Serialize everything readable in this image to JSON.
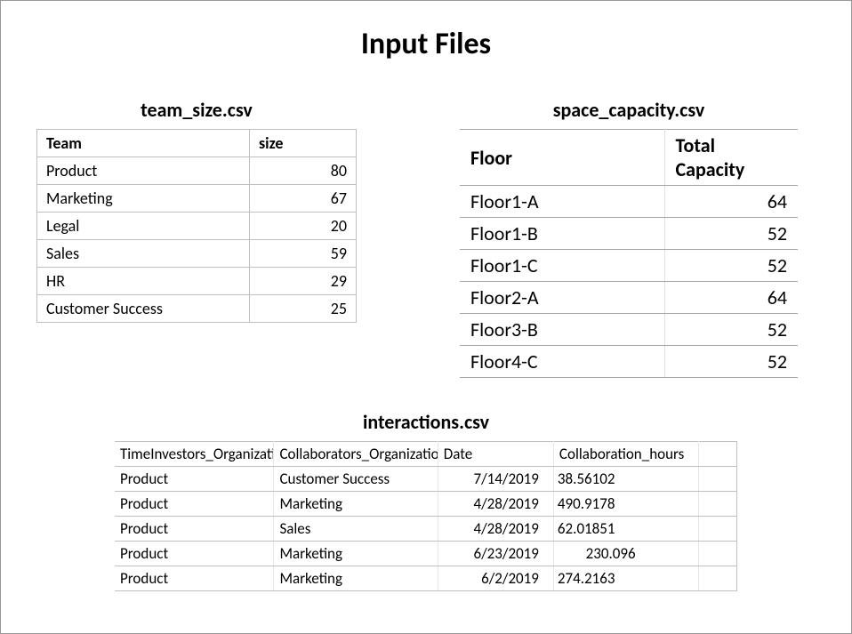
{
  "title": "Input Files",
  "team_size": {
    "filename": "team_size.csv",
    "headers": [
      "Team",
      "size"
    ],
    "rows": [
      {
        "team": "Product",
        "size": "80"
      },
      {
        "team": "Marketing",
        "size": "67"
      },
      {
        "team": "Legal",
        "size": "20"
      },
      {
        "team": "Sales",
        "size": "59"
      },
      {
        "team": "HR",
        "size": "29"
      },
      {
        "team": "Customer Success",
        "size": "25"
      }
    ]
  },
  "space_capacity": {
    "filename": "space_capacity.csv",
    "headers": [
      "Floor",
      "Total Capacity"
    ],
    "rows": [
      {
        "floor": "Floor1-A",
        "capacity": "64"
      },
      {
        "floor": "Floor1-B",
        "capacity": "52"
      },
      {
        "floor": "Floor1-C",
        "capacity": "52"
      },
      {
        "floor": "Floor2-A",
        "capacity": "64"
      },
      {
        "floor": "Floor3-B",
        "capacity": "52"
      },
      {
        "floor": "Floor4-C",
        "capacity": "52"
      }
    ]
  },
  "interactions": {
    "filename": "interactions.csv",
    "headers": [
      "TimeInvestors_Organization",
      "Collaborators_Organization",
      "Date",
      "Collaboration_hours"
    ],
    "rows": [
      {
        "ti": "Product",
        "co": "Customer Success",
        "date": "7/14/2019",
        "hours": "38.56102"
      },
      {
        "ti": "Product",
        "co": "Marketing",
        "date": "4/28/2019",
        "hours": "490.9178"
      },
      {
        "ti": "Product",
        "co": "Sales",
        "date": "4/28/2019",
        "hours": "62.01851"
      },
      {
        "ti": "Product",
        "co": "Marketing",
        "date": "6/23/2019",
        "hours": "230.096"
      },
      {
        "ti": "Product",
        "co": "Marketing",
        "date": "6/2/2019",
        "hours": "274.2163"
      }
    ]
  }
}
